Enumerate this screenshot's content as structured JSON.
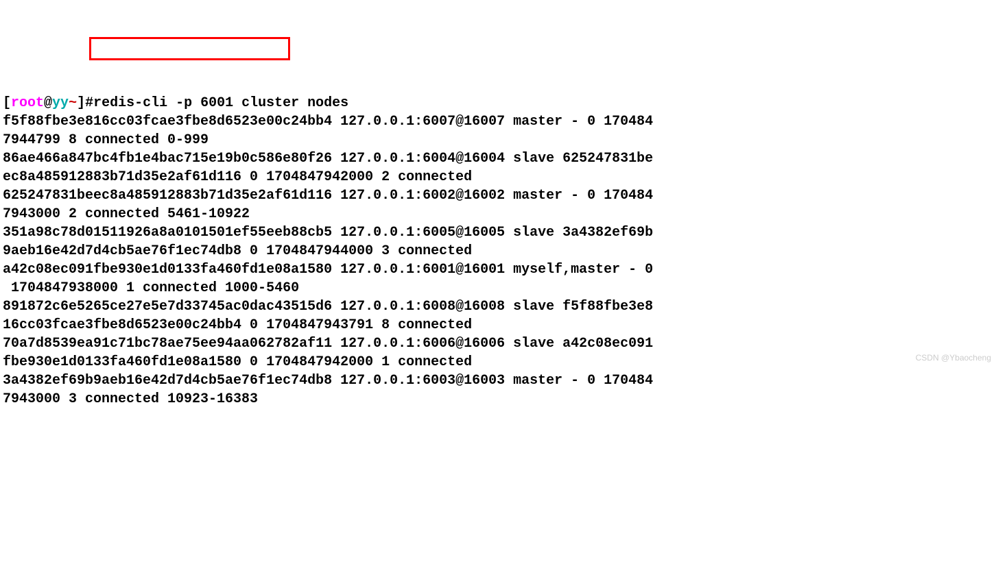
{
  "truncated_top": "",
  "prompt": {
    "bracket_open": "[",
    "root": "root",
    "at": "@",
    "host": "yy",
    "tilde": "~",
    "bracket_close": "]",
    "hash": "#"
  },
  "command": "redis-cli -p 6001 cluster nodes",
  "lines": [
    "f5f88fbe3e816cc03fcae3fbe8d6523e00c24bb4 127.0.0.1:6007@16007 master - 0 170484",
    "7944799 8 connected 0-999",
    "86ae466a847bc4fb1e4bac715e19b0c586e80f26 127.0.0.1:6004@16004 slave 625247831be",
    "ec8a485912883b71d35e2af61d116 0 1704847942000 2 connected",
    "625247831beec8a485912883b71d35e2af61d116 127.0.0.1:6002@16002 master - 0 170484",
    "7943000 2 connected 5461-10922",
    "351a98c78d01511926a8a0101501ef55eeb88cb5 127.0.0.1:6005@16005 slave 3a4382ef69b",
    "9aeb16e42d7d4cb5ae76f1ec74db8 0 1704847944000 3 connected",
    "a42c08ec091fbe930e1d0133fa460fd1e08a1580 127.0.0.1:6001@16001 myself,master - 0",
    " 1704847938000 1 connected 1000-5460",
    "891872c6e5265ce27e5e7d33745ac0dac43515d6 127.0.0.1:6008@16008 slave f5f88fbe3e8",
    "16cc03fcae3fbe8d6523e00c24bb4 0 1704847943791 8 connected",
    "70a7d8539ea91c71bc78ae75ee94aa062782af11 127.0.0.1:6006@16006 slave a42c08ec091",
    "fbe930e1d0133fa460fd1e08a1580 0 1704847942000 1 connected",
    "3a4382ef69b9aeb16e42d7d4cb5ae76f1ec74db8 127.0.0.1:6003@16003 master - 0 170484",
    "7943000 3 connected 10923-16383"
  ],
  "watermark": "CSDN @Ybaocheng"
}
